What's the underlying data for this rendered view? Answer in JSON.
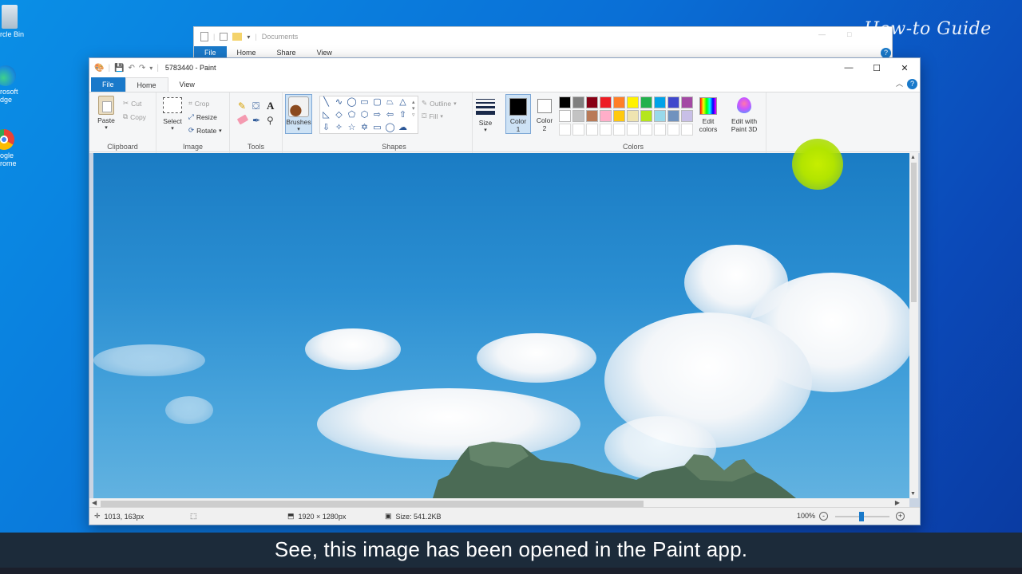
{
  "desktop": {
    "icons": [
      {
        "label_line1": "rcle Bin",
        "label_line2": "",
        "icon": "recycle-bin-icon"
      },
      {
        "label_line1": "rosoft",
        "label_line2": "dge",
        "icon": "edge-icon"
      },
      {
        "label_line1": "ogle",
        "label_line2": "rome",
        "icon": "chrome-icon"
      }
    ],
    "watermark": "How-to Guide"
  },
  "explorer": {
    "title": "Documents",
    "tabs": [
      "File",
      "Home",
      "Share",
      "View"
    ]
  },
  "paint": {
    "title": "5783440 - Paint",
    "tabs": {
      "file": "File",
      "home": "Home",
      "view": "View"
    },
    "clipboard": {
      "paste": "Paste",
      "cut": "Cut",
      "copy": "Copy",
      "group": "Clipboard"
    },
    "image": {
      "select": "Select",
      "crop": "Crop",
      "resize": "Resize",
      "rotate": "Rotate",
      "group": "Image"
    },
    "tools": {
      "group": "Tools",
      "brushes": "Brushes"
    },
    "shapes": {
      "outline": "Outline",
      "fill": "Fill",
      "group": "Shapes"
    },
    "size": "Size",
    "color1_line1": "Color",
    "color1_line2": "1",
    "color2_line1": "Color",
    "color2_line2": "2",
    "colors_group": "Colors",
    "edit_colors_line1": "Edit",
    "edit_colors_line2": "colors",
    "edit_3d_line1": "Edit with",
    "edit_3d_line2": "Paint 3D",
    "palette_row1": [
      "#000000",
      "#7f7f7f",
      "#880015",
      "#ed1c24",
      "#ff7f27",
      "#fff200",
      "#22b14c",
      "#00a2e8",
      "#3f48cc",
      "#a349a4"
    ],
    "palette_row2": [
      "#ffffff",
      "#c3c3c3",
      "#b97a57",
      "#ffaec9",
      "#ffc90e",
      "#efe4b0",
      "#b5e61d",
      "#99d9ea",
      "#7092be",
      "#c8bfe7"
    ],
    "status": {
      "cursor": "1013, 163px",
      "dimensions": "1920 × 1280px",
      "size": "Size: 541.2KB",
      "zoom": "100%"
    }
  },
  "caption": "See, this image has been opened in the Paint app."
}
